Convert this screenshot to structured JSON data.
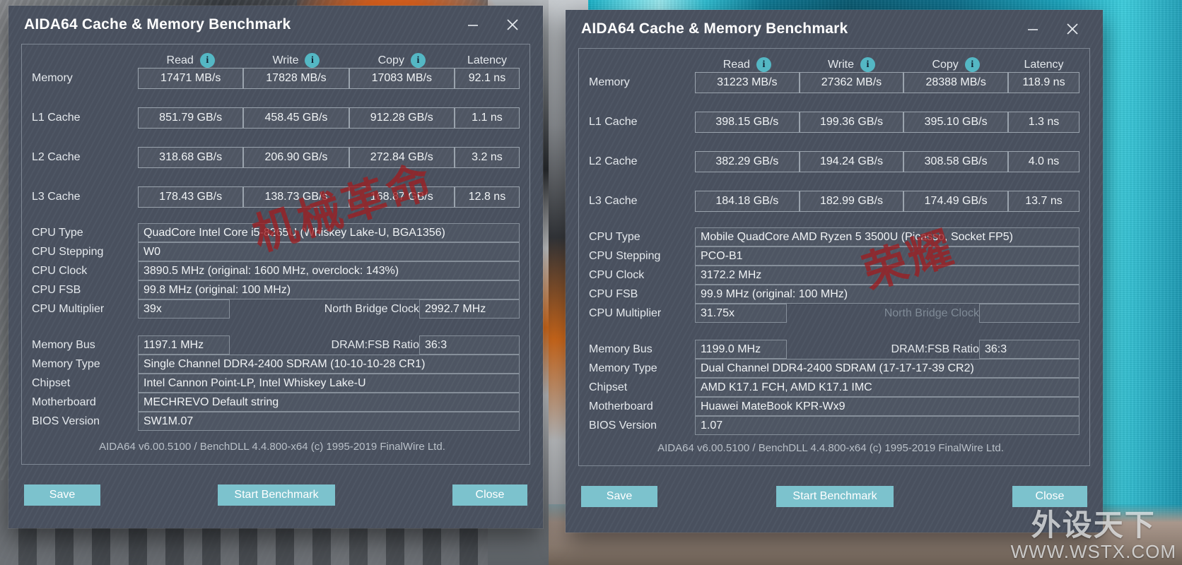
{
  "colors": {
    "dialog_bg": "#4a5260",
    "button_teal": "#7cc2cd",
    "info_icon": "#54b7c4",
    "watermark_red": "#9d1f22"
  },
  "columns": [
    "Read",
    "Write",
    "Copy",
    "Latency"
  ],
  "info_icon_label": "i",
  "window_controls": {
    "minimize": "minimize-icon",
    "close": "close-icon"
  },
  "left": {
    "title": "AIDA64 Cache & Memory Benchmark",
    "bench": {
      "rows": [
        {
          "label": "Memory",
          "read": "17471 MB/s",
          "write": "17828 MB/s",
          "copy": "17083 MB/s",
          "latency": "92.1 ns"
        },
        {
          "label": "L1 Cache",
          "read": "851.79 GB/s",
          "write": "458.45 GB/s",
          "copy": "912.28 GB/s",
          "latency": "1.1 ns"
        },
        {
          "label": "L2 Cache",
          "read": "318.68 GB/s",
          "write": "206.90 GB/s",
          "copy": "272.84 GB/s",
          "latency": "3.2 ns"
        },
        {
          "label": "L3 Cache",
          "read": "178.43 GB/s",
          "write": "138.73 GB/s",
          "copy": "168.87 GB/s",
          "latency": "12.8 ns"
        }
      ]
    },
    "info": {
      "cpu_type_label": "CPU Type",
      "cpu_type": "QuadCore Intel Core i5-8265U  (Whiskey Lake-U, BGA1356)",
      "cpu_stepping_label": "CPU Stepping",
      "cpu_stepping": "W0",
      "cpu_clock_label": "CPU Clock",
      "cpu_clock": "3890.5 MHz  (original: 1600 MHz, overclock: 143%)",
      "cpu_fsb_label": "CPU FSB",
      "cpu_fsb": "99.8 MHz  (original: 100 MHz)",
      "cpu_multiplier_label": "CPU Multiplier",
      "cpu_multiplier": "39x",
      "north_bridge_label": "North Bridge Clock",
      "north_bridge": "2992.7 MHz",
      "memory_bus_label": "Memory Bus",
      "memory_bus": "1197.1 MHz",
      "dram_fsb_label": "DRAM:FSB Ratio",
      "dram_fsb": "36:3",
      "memory_type_label": "Memory Type",
      "memory_type": "Single Channel DDR4-2400 SDRAM  (10-10-10-28 CR1)",
      "chipset_label": "Chipset",
      "chipset": "Intel Cannon Point-LP, Intel Whiskey Lake-U",
      "motherboard_label": "Motherboard",
      "motherboard": "MECHREVO Default string",
      "bios_label": "BIOS Version",
      "bios": "SW1M.07"
    },
    "credit": "AIDA64 v6.00.5100 / BenchDLL 4.4.800-x64  (c) 1995-2019 FinalWire Ltd.",
    "buttons": {
      "save": "Save",
      "start": "Start Benchmark",
      "close": "Close"
    },
    "watermark": "机械革命"
  },
  "right": {
    "title": "AIDA64 Cache & Memory Benchmark",
    "bench": {
      "rows": [
        {
          "label": "Memory",
          "read": "31223 MB/s",
          "write": "27362 MB/s",
          "copy": "28388 MB/s",
          "latency": "118.9 ns"
        },
        {
          "label": "L1 Cache",
          "read": "398.15 GB/s",
          "write": "199.36 GB/s",
          "copy": "395.10 GB/s",
          "latency": "1.3 ns"
        },
        {
          "label": "L2 Cache",
          "read": "382.29 GB/s",
          "write": "194.24 GB/s",
          "copy": "308.58 GB/s",
          "latency": "4.0 ns"
        },
        {
          "label": "L3 Cache",
          "read": "184.18 GB/s",
          "write": "182.99 GB/s",
          "copy": "174.49 GB/s",
          "latency": "13.7 ns"
        }
      ]
    },
    "info": {
      "cpu_type_label": "CPU Type",
      "cpu_type": "Mobile QuadCore AMD Ryzen 5 3500U  (Picasso, Socket FP5)",
      "cpu_stepping_label": "CPU Stepping",
      "cpu_stepping": "PCO-B1",
      "cpu_clock_label": "CPU Clock",
      "cpu_clock": "3172.2 MHz",
      "cpu_fsb_label": "CPU FSB",
      "cpu_fsb": "99.9 MHz  (original: 100 MHz)",
      "cpu_multiplier_label": "CPU Multiplier",
      "cpu_multiplier": "31.75x",
      "north_bridge_label": "North Bridge Clock",
      "north_bridge": "",
      "memory_bus_label": "Memory Bus",
      "memory_bus": "1199.0 MHz",
      "dram_fsb_label": "DRAM:FSB Ratio",
      "dram_fsb": "36:3",
      "memory_type_label": "Memory Type",
      "memory_type": "Dual Channel DDR4-2400 SDRAM  (17-17-17-39 CR2)",
      "chipset_label": "Chipset",
      "chipset": "AMD K17.1 FCH, AMD K17.1 IMC",
      "motherboard_label": "Motherboard",
      "motherboard": "Huawei MateBook KPR-Wx9",
      "bios_label": "BIOS Version",
      "bios": "1.07"
    },
    "credit": "AIDA64 v6.00.5100 / BenchDLL 4.4.800-x64  (c) 1995-2019 FinalWire Ltd.",
    "buttons": {
      "save": "Save",
      "start": "Start Benchmark",
      "close": "Close"
    },
    "watermark": "荣耀"
  },
  "site_watermark": {
    "cn": "外设天下",
    "url": "WWW.WSTX.COM"
  }
}
